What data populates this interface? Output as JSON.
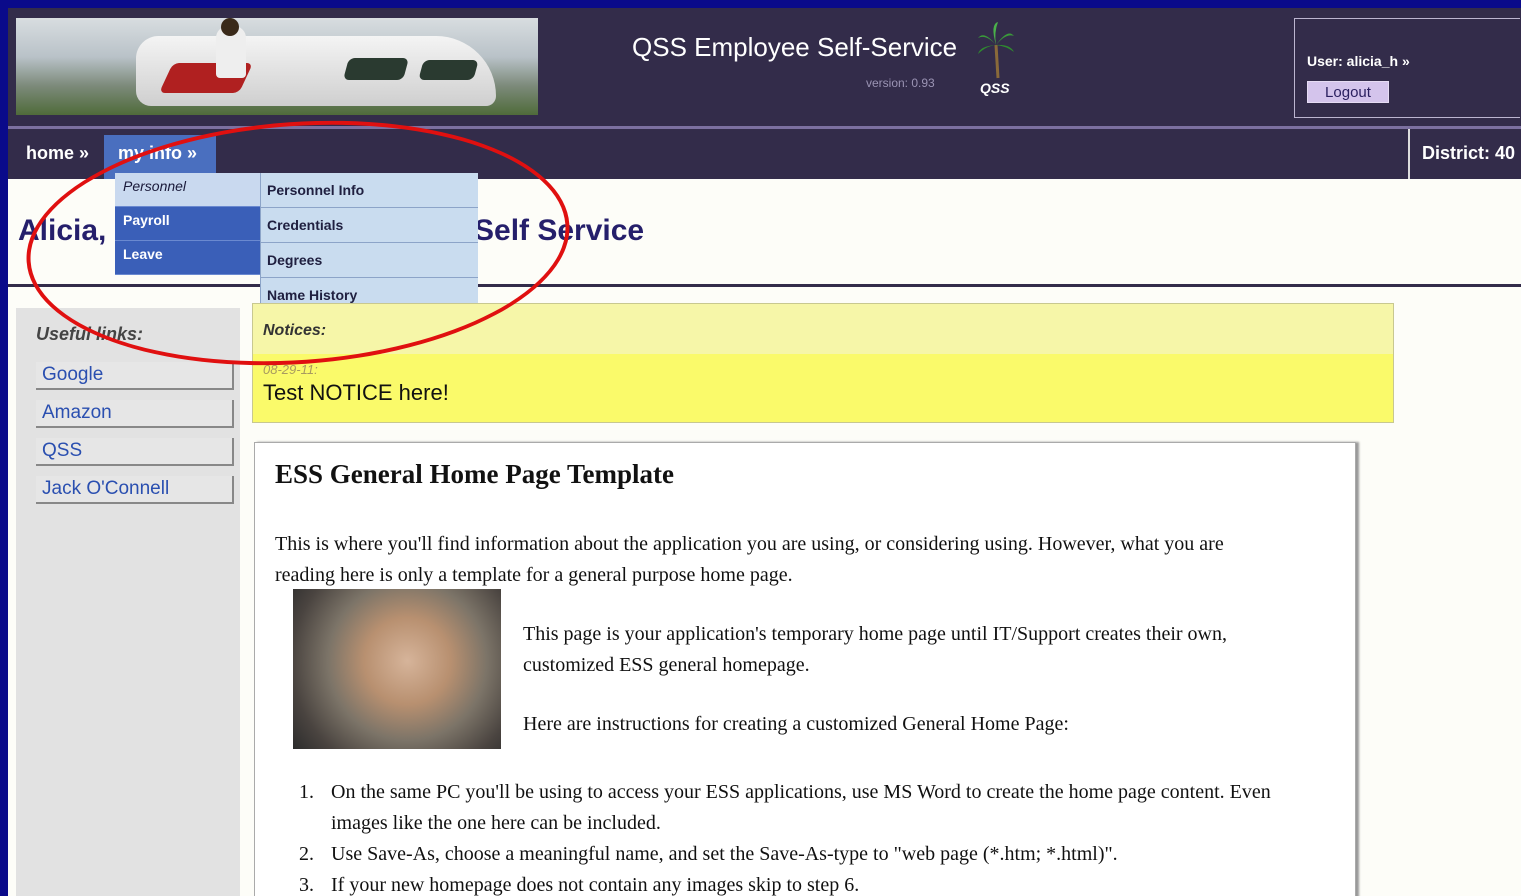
{
  "header": {
    "app_title": "QSS Employee Self-Service",
    "version": "version: 0.93",
    "logo_label": "QSS",
    "user_label": "User: alicia_h »",
    "logout_label": "Logout"
  },
  "nav": {
    "home": "home »",
    "my_info": "my info »",
    "district": "District: 40"
  },
  "dropdown": {
    "categories": [
      "Personnel",
      "Payroll",
      "Leave"
    ],
    "items": [
      "Personnel Info",
      "Credentials",
      "Degrees",
      "Name History"
    ]
  },
  "welcome": {
    "start": "Alicia,",
    "end": "Self Service"
  },
  "sidebar": {
    "title": "Useful links:",
    "links": [
      "Google",
      "Amazon",
      "QSS",
      "Jack O'Connell"
    ]
  },
  "notices": {
    "label": "Notices:",
    "date": "08-29-11:",
    "text": "Test NOTICE here!"
  },
  "content": {
    "heading": "ESS General Home Page Template",
    "intro": "This is where you'll find information about the application you are using, or considering using. However, what you are reading here is only a template for a general purpose home page.",
    "temp_home": "This page is your application's temporary home page until IT/Support creates their own, customized ESS general homepage.",
    "instructions_intro": "Here are instructions for creating a customized General Home Page:",
    "steps": [
      "On the same PC you'll be using to access your ESS applications, use MS Word to create the home page content. Even images like the one here can be included.",
      "Use Save-As, choose a meaningful name, and set the Save-As-type to \"web page (*.htm; *.html)\".",
      "If your new homepage does not contain any images skip to step 6."
    ]
  },
  "annotation_color": "#e01010"
}
